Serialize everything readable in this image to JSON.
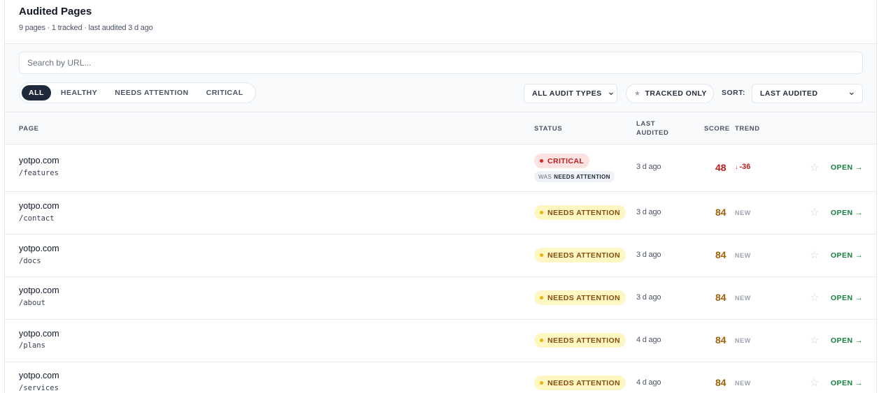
{
  "header": {
    "title": "Audited Pages",
    "subtitle": "9 pages · 1 tracked · last audited 3 d ago"
  },
  "search": {
    "placeholder": "Search by URL..."
  },
  "filters": {
    "segments": [
      "ALL",
      "HEALTHY",
      "NEEDS ATTENTION",
      "CRITICAL"
    ],
    "active": "ALL",
    "audit_types": "ALL AUDIT TYPES",
    "tracked_only": "TRACKED ONLY",
    "sort_label": "SORT:",
    "sort_value": "LAST AUDITED"
  },
  "columns": {
    "page": "PAGE",
    "status": "STATUS",
    "last_audited_1": "LAST",
    "last_audited_2": "AUDITED",
    "score": "SCORE",
    "trend": "TREND"
  },
  "rows": [
    {
      "domain": "yotpo.com",
      "path": "/features",
      "status": "CRITICAL",
      "was_label": "WAS",
      "was_status": "NEEDS ATTENTION",
      "audited": "3 d ago",
      "score": "48",
      "trend": "-36",
      "open": "OPEN →"
    },
    {
      "domain": "yotpo.com",
      "path": "/contact",
      "status": "NEEDS ATTENTION",
      "audited": "3 d ago",
      "score": "84",
      "trend": "NEW",
      "open": "OPEN →"
    },
    {
      "domain": "yotpo.com",
      "path": "/docs",
      "status": "NEEDS ATTENTION",
      "audited": "3 d ago",
      "score": "84",
      "trend": "NEW",
      "open": "OPEN →"
    },
    {
      "domain": "yotpo.com",
      "path": "/about",
      "status": "NEEDS ATTENTION",
      "audited": "3 d ago",
      "score": "84",
      "trend": "NEW",
      "open": "OPEN →"
    },
    {
      "domain": "yotpo.com",
      "path": "/plans",
      "status": "NEEDS ATTENTION",
      "audited": "4 d ago",
      "score": "84",
      "trend": "NEW",
      "open": "OPEN →"
    },
    {
      "domain": "yotpo.com",
      "path": "/services",
      "status": "NEEDS ATTENTION",
      "audited": "4 d ago",
      "score": "84",
      "trend": "NEW",
      "open": "OPEN →"
    }
  ],
  "icons": {
    "star": "star-icon",
    "chevron": "chevron-down-icon",
    "trend_down": "arrow-down-icon"
  },
  "colors": {
    "critical": "#b91c1c",
    "warning": "#a16207",
    "open": "#15803d",
    "active_segment": "#1e293b"
  }
}
